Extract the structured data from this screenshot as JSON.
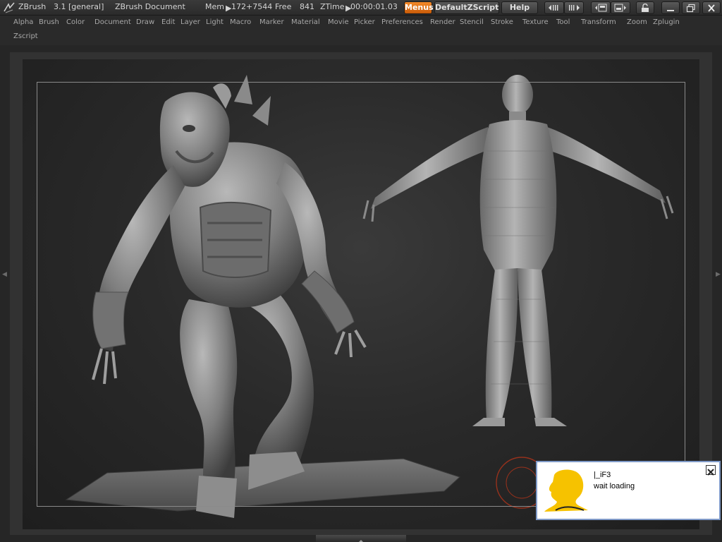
{
  "title_bar": {
    "app_name": "ZBrush",
    "version": "3.1 [general]",
    "document": "ZBrush Document",
    "mem_label": "Mem",
    "mem_value": "172+7544",
    "free_label": "Free",
    "free_value": "841",
    "ztime_label": "ZTime",
    "ztime_value": "00:00:01.03",
    "menus_button": "Menus",
    "zscript_button": "DefaultZScript",
    "help_button": "Help"
  },
  "menus": [
    "Alpha",
    "Brush",
    "Color",
    "Document",
    "Draw",
    "Edit",
    "Layer",
    "Light",
    "Macro",
    "Marker",
    "Material",
    "Movie",
    "Picker",
    "Preferences",
    "Render",
    "Stencil",
    "Stroke",
    "Texture",
    "Tool",
    "Transform",
    "Zoom",
    "Zplugin",
    "Zscript"
  ],
  "popup": {
    "title": "|_iF3",
    "message": "wait loading"
  },
  "colors": {
    "accent_orange": "#e8741a",
    "background": "#262626",
    "popup_border": "#7f9ac8",
    "avatar_yellow": "#f6c200"
  },
  "icons": [
    "zbrush-logo-icon",
    "scroll-left-icon",
    "scroll-right-icon",
    "layout-a-icon",
    "layout-b-icon",
    "lock-icon",
    "minimize-icon",
    "maximize-icon",
    "close-icon",
    "popup-close-icon",
    "user-avatar-icon"
  ]
}
